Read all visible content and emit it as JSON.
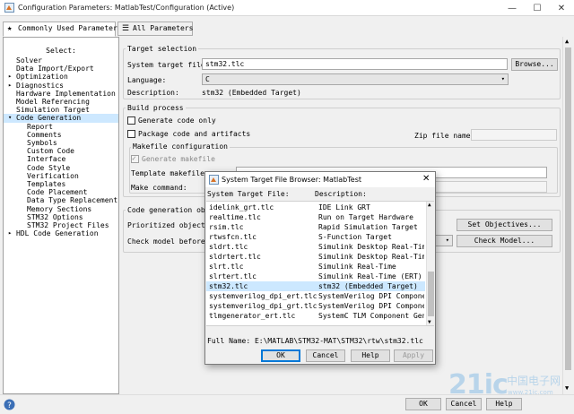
{
  "window": {
    "title": "Configuration Parameters: MatlabTest/Configuration (Active)",
    "minimize": "—",
    "maximize": "☐",
    "close": "✕"
  },
  "tabs": [
    {
      "label": "Commonly Used Parameters",
      "glyph": "★"
    },
    {
      "label": "All Parameters",
      "glyph": "☰"
    }
  ],
  "tree": {
    "select_label": "Select:",
    "items": [
      {
        "label": "Solver",
        "level": 0,
        "expander": ""
      },
      {
        "label": "Data Import/Export",
        "level": 0,
        "expander": ""
      },
      {
        "label": "Optimization",
        "level": 0,
        "expander": "▸"
      },
      {
        "label": "Diagnostics",
        "level": 0,
        "expander": "▸"
      },
      {
        "label": "Hardware Implementation",
        "level": 0,
        "expander": ""
      },
      {
        "label": "Model Referencing",
        "level": 0,
        "expander": ""
      },
      {
        "label": "Simulation Target",
        "level": 0,
        "expander": ""
      },
      {
        "label": "Code Generation",
        "level": 0,
        "expander": "▾",
        "selected": true
      },
      {
        "label": "Report",
        "level": 1
      },
      {
        "label": "Comments",
        "level": 1
      },
      {
        "label": "Symbols",
        "level": 1
      },
      {
        "label": "Custom Code",
        "level": 1
      },
      {
        "label": "Interface",
        "level": 1
      },
      {
        "label": "Code Style",
        "level": 1
      },
      {
        "label": "Verification",
        "level": 1
      },
      {
        "label": "Templates",
        "level": 1
      },
      {
        "label": "Code Placement",
        "level": 1
      },
      {
        "label": "Data Type Replacement",
        "level": 1
      },
      {
        "label": "Memory Sections",
        "level": 1
      },
      {
        "label": "STM32 Options",
        "level": 1
      },
      {
        "label": "STM32 Project Files",
        "level": 1
      },
      {
        "label": "HDL Code Generation",
        "level": 0,
        "expander": "▸"
      }
    ]
  },
  "target_selection": {
    "group_title": "Target selection",
    "system_target_file_label": "System target file:",
    "system_target_file_value": "stm32.tlc",
    "browse_button": "Browse...",
    "language_label": "Language:",
    "language_value": "C",
    "description_label": "Description:",
    "description_value": "stm32 (Embedded Target)"
  },
  "build_process": {
    "group_title": "Build process",
    "generate_code_only": "Generate code only",
    "package_code": "Package code and artifacts",
    "zip_file_name_label": "Zip file name:",
    "makefile_config_title": "Makefile configuration",
    "generate_makefile": "Generate makefile",
    "template_makefile_label": "Template makefile:",
    "make_command_label": "Make command:"
  },
  "code_gen_objectives": {
    "group_title": "Code generation obje",
    "prioritized_label": "Prioritized objectiv",
    "set_objectives_button": "Set Objectives...",
    "check_model_label": "Check model before g",
    "check_model_button": "Check Model..."
  },
  "bottom": {
    "ok_button": "OK",
    "cancel_button": "Cancel",
    "help_button": "Help"
  },
  "dialog": {
    "title": "System Target File Browser: MatlabTest",
    "col1_header": "System Target File:",
    "col2_header": "Description:",
    "rows": [
      {
        "file": "idelink_grt.tlc",
        "desc": "IDE Link GRT"
      },
      {
        "file": "realtime.tlc",
        "desc": "Run on Target Hardware"
      },
      {
        "file": "rsim.tlc",
        "desc": "Rapid Simulation Target"
      },
      {
        "file": "rtwsfcn.tlc",
        "desc": "S-Function Target"
      },
      {
        "file": "sldrt.tlc",
        "desc": "Simulink Desktop Real-Time"
      },
      {
        "file": "sldrtert.tlc",
        "desc": "Simulink Desktop Real-Time"
      },
      {
        "file": "slrt.tlc",
        "desc": "Simulink Real-Time"
      },
      {
        "file": "slrtert.tlc",
        "desc": "Simulink Real-Time (ERT)"
      },
      {
        "file": "stm32.tlc",
        "desc": "stm32 (Embedded Target)",
        "selected": true
      },
      {
        "file": "systemverilog_dpi_ert.tlc",
        "desc": "SystemVerilog DPI Component"
      },
      {
        "file": "systemverilog_dpi_grt.tlc",
        "desc": "SystemVerilog DPI Component"
      },
      {
        "file": "tlmgenerator_ert.tlc",
        "desc": "SystemC TLM Component Gen"
      }
    ],
    "full_name": "Full Name: E:\\MATLAB\\STM32-MAT\\STM32\\rtw\\stm32.tlc",
    "ok_button": "OK",
    "cancel_button": "Cancel",
    "help_button": "Help",
    "apply_button": "Apply"
  },
  "watermark": {
    "text": "21ic",
    "sub": "中国电子网",
    "url": "www.21ic.com"
  },
  "colors": {
    "selection": "#cde8ff",
    "accent_blue": "#0078d7",
    "watermark": "#b8d4ea"
  }
}
